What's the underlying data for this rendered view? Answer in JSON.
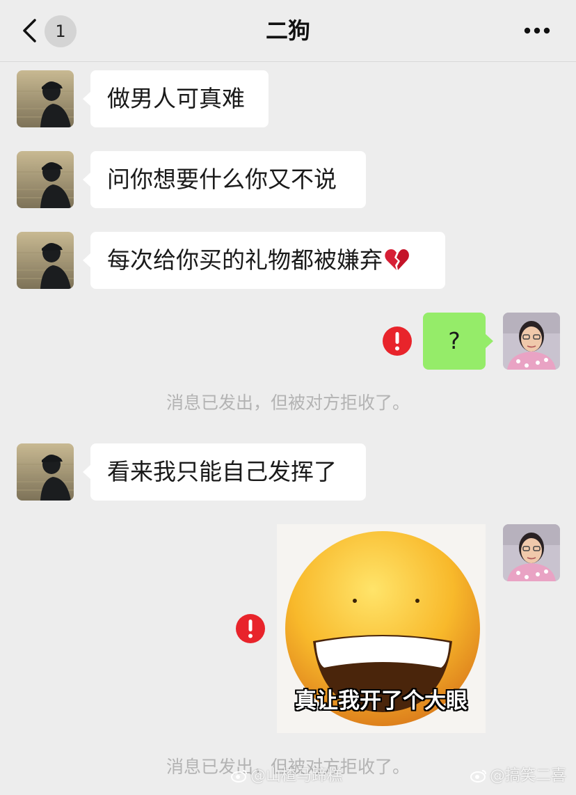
{
  "header": {
    "title": "二狗",
    "unread_count": "1",
    "back_icon": "chevron-left-icon",
    "more_icon": "more-dots-icon"
  },
  "messages": [
    {
      "side": "left",
      "text": "做男人可真难"
    },
    {
      "side": "left",
      "text": "问你想要什么你又不说"
    },
    {
      "side": "left",
      "text": "每次给你买的礼物都被嫌弃",
      "emoji": "broken-heart-icon"
    },
    {
      "side": "right",
      "text": "?",
      "status": "failed"
    },
    {
      "side": "system",
      "text": "消息已发出，但被对方拒收了。"
    },
    {
      "side": "left",
      "text": "看来我只能自己发挥了"
    },
    {
      "side": "right",
      "type": "sticker",
      "caption": "真让我开了个大眼",
      "status": "failed"
    },
    {
      "side": "system",
      "text": "消息已发出，但被对方拒收了。"
    }
  ],
  "watermarks": {
    "left": "@山楂马蹄糕",
    "right": "@搞笑二喜"
  },
  "colors": {
    "background": "#ededed",
    "bubble_left": "#ffffff",
    "bubble_right": "#95ec69",
    "error": "#e8242b",
    "system_text": "#b3b3b3"
  }
}
